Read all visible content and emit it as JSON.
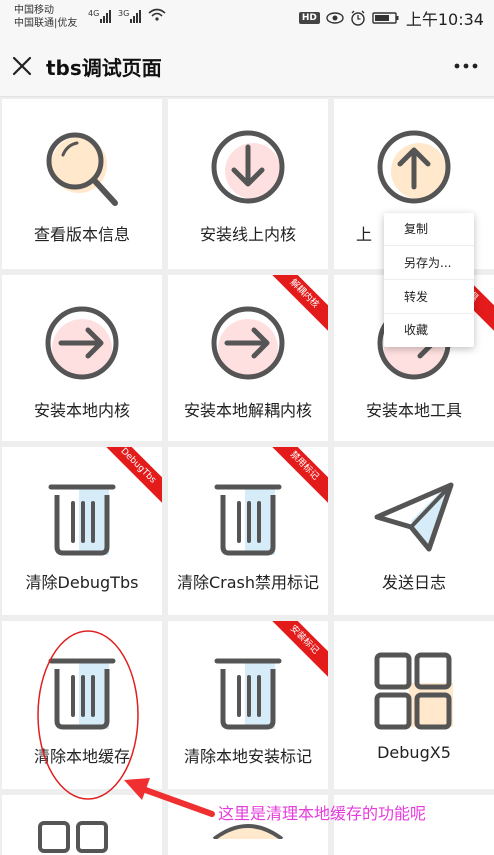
{
  "status_bar": {
    "carrier_line1": "中国移动",
    "carrier_line2": "中国联通|优友",
    "net1": "4G",
    "net2": "3G",
    "hd": "HD",
    "time": "上午10:34"
  },
  "title_bar": {
    "title": "tbs调试页面"
  },
  "grid": {
    "items": [
      {
        "label": "查看版本信息",
        "icon": "search-icon",
        "ribbon": ""
      },
      {
        "label": "安装线上内核",
        "icon": "download-icon",
        "ribbon": ""
      },
      {
        "label": "上",
        "icon": "upload-icon",
        "ribbon": ""
      },
      {
        "label": "安装本地内核",
        "icon": "arrow-right-icon",
        "ribbon": ""
      },
      {
        "label": "安装本地解耦内核",
        "icon": "arrow-right-icon",
        "ribbon": "解耦内核"
      },
      {
        "label": "安装本地工具",
        "icon": "arrow-right-icon",
        "ribbon": "工具"
      },
      {
        "label": "清除DebugTbs",
        "icon": "trash-icon",
        "ribbon": "DebugTbs"
      },
      {
        "label": "清除Crash禁用标记",
        "icon": "trash-icon",
        "ribbon": "禁用标记"
      },
      {
        "label": "发送日志",
        "icon": "paper-plane-icon",
        "ribbon": ""
      },
      {
        "label": "清除本地缓存",
        "icon": "trash-icon",
        "ribbon": ""
      },
      {
        "label": "清除本地安装标记",
        "icon": "trash-icon",
        "ribbon": "安装标记"
      },
      {
        "label": "DebugX5",
        "icon": "grid-icon",
        "ribbon": ""
      }
    ]
  },
  "context_menu": {
    "items": [
      "复制",
      "另存为...",
      "转发",
      "收藏"
    ]
  },
  "annotation": {
    "text": "这里是清理本地缓存的功能呢",
    "color": "#e63cdc",
    "ellipse_color": "#e02020",
    "arrow_color": "#f03030"
  },
  "colors": {
    "accent_red": "#e41b1b",
    "circle_pink": "#ffe0e0",
    "circle_orange": "#ffe8cc",
    "trash_blue": "#d6ecf8",
    "icon_stroke": "#555555"
  }
}
